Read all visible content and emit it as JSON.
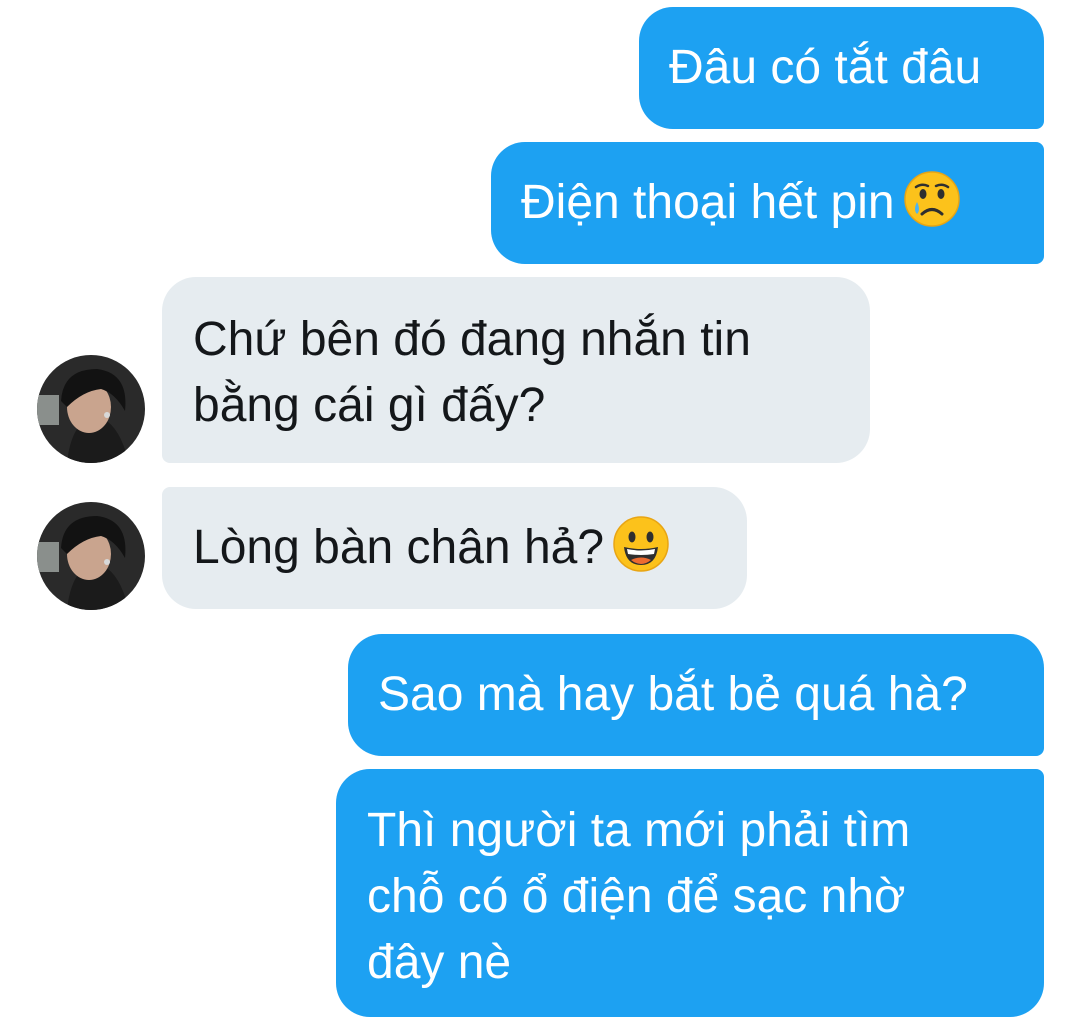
{
  "messages": [
    {
      "direction": "outgoing",
      "lines": [
        "Đâu có tắt đâu"
      ]
    },
    {
      "direction": "outgoing",
      "lines": [
        "Điện thoại hết pin"
      ],
      "emoji": "crying-face-icon"
    },
    {
      "direction": "incoming",
      "lines": [
        "Chứ bên đó đang nhắn tin",
        "bằng cái gì đấy?"
      ],
      "avatar": "contact-avatar"
    },
    {
      "direction": "incoming",
      "lines": [
        "Lòng bàn chân hả?"
      ],
      "emoji": "grinning-face-icon",
      "avatar": "contact-avatar"
    },
    {
      "direction": "outgoing",
      "lines": [
        "Sao mà hay bắt bẻ quá hà?"
      ]
    },
    {
      "direction": "outgoing",
      "lines": [
        "Thì người ta mới phải tìm",
        "chỗ có ổ điện để sạc nhờ",
        "đây nè"
      ]
    }
  ],
  "colors": {
    "outgoing_bubble": "#1da1f2",
    "incoming_bubble": "#e6ecf0",
    "outgoing_text": "#ffffff",
    "incoming_text": "#14171a"
  }
}
